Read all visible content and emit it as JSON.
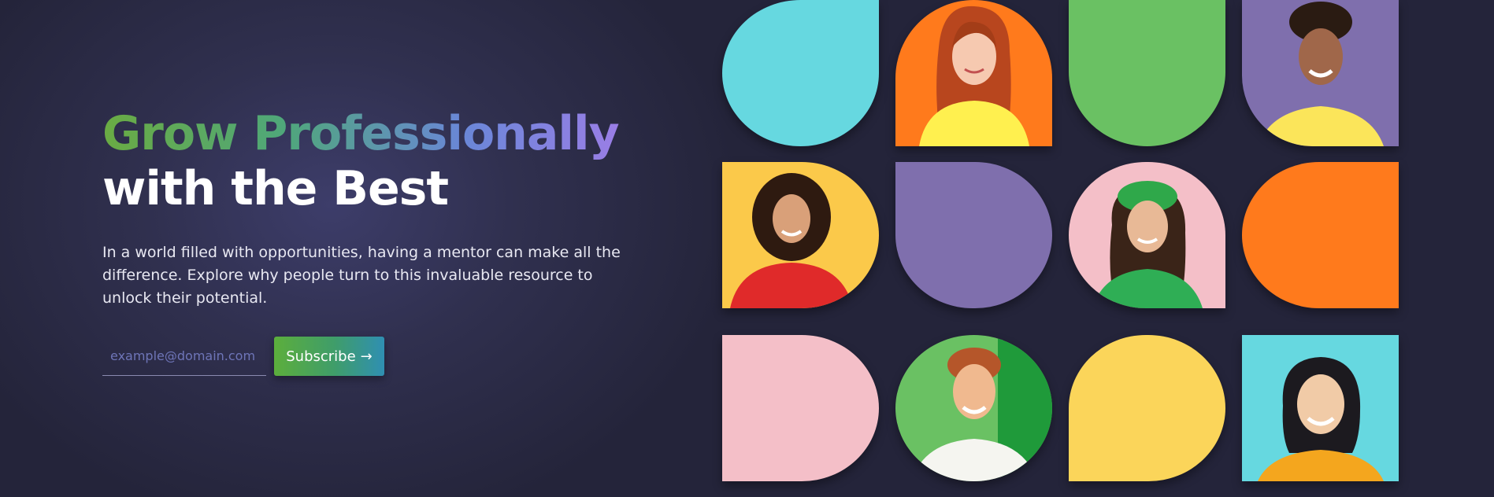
{
  "hero": {
    "headline_line1": "Grow Professionally",
    "headline_line2": "with the Best",
    "description": "In a world filled with opportunities, having a mentor can make all the difference. Explore why people turn to this invaluable resource to unlock their potential.",
    "email_placeholder": "example@domain.com",
    "email_value": "",
    "subscribe_label": "Subscribe",
    "subscribe_icon": "arrow-right-icon",
    "arrow_glyph": "→"
  },
  "colors": {
    "background": "#2b2b46",
    "gradient_green": "#6aab43",
    "gradient_purple": "#9a7ee6",
    "cyan": "#66d8e0",
    "orange": "#ff7a1c",
    "green": "#6ac163",
    "purple": "#7f6fad",
    "yellow": "#fbd55a",
    "pink": "#f4bfc8"
  },
  "tiles": [
    {
      "name": "tile-cyan",
      "kind": "color",
      "color": "#66d8e0"
    },
    {
      "name": "tile-portrait-redhead-woman",
      "kind": "portrait",
      "color": "#ff7a1c"
    },
    {
      "name": "tile-green",
      "kind": "color",
      "color": "#6ac163"
    },
    {
      "name": "tile-portrait-curly-man",
      "kind": "portrait",
      "color": "#7f6fad"
    },
    {
      "name": "tile-portrait-curly-woman",
      "kind": "portrait",
      "color": "#fbc94a"
    },
    {
      "name": "tile-purple",
      "kind": "color",
      "color": "#7f6fad"
    },
    {
      "name": "tile-portrait-beret-woman",
      "kind": "portrait",
      "color": "#f4bfc8"
    },
    {
      "name": "tile-orange",
      "kind": "color",
      "color": "#ff7a1c"
    },
    {
      "name": "tile-pink",
      "kind": "color",
      "color": "#f4bfc8"
    },
    {
      "name": "tile-portrait-ginger-man",
      "kind": "portrait",
      "color": "#6ac163"
    },
    {
      "name": "tile-yellow",
      "kind": "color",
      "color": "#fbd55a"
    },
    {
      "name": "tile-portrait-smiling-woman",
      "kind": "portrait",
      "color": "#66d8e0"
    }
  ]
}
